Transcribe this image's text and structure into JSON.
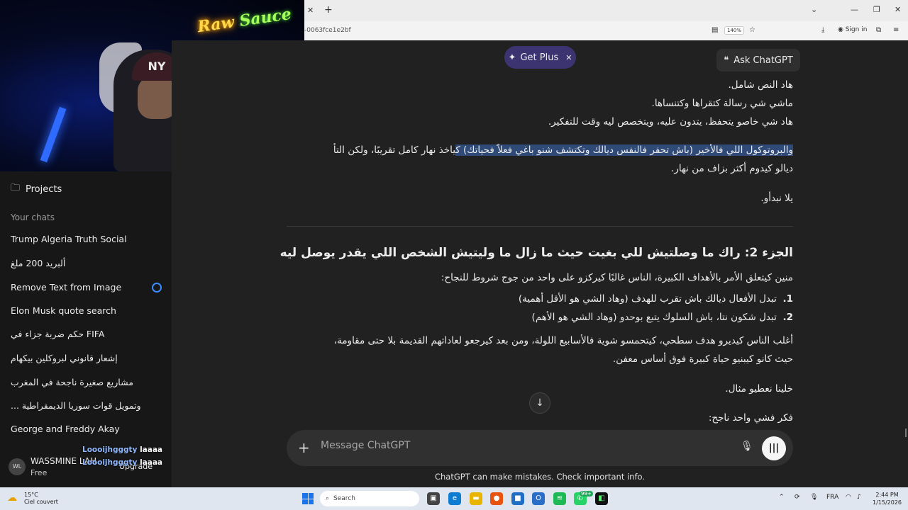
{
  "browser": {
    "url_fragment": "-0063fce1e2bf",
    "zoom": "140%",
    "signin_label": "Sign in"
  },
  "webcam": {
    "neon_text_a": "Raw",
    "neon_text_b": "Sauce"
  },
  "sidebar": {
    "projects_label": "Projects",
    "chats_heading": "Your chats",
    "chats": [
      "Trump Algeria Truth Social",
      "ألبريد 200 ملغ",
      "Remove Text from Image",
      "Elon Musk quote search",
      "حكم ضربة جزاء في FIFA",
      "إشعار قانوني لبروكلين بيكهام",
      "مشاريع صغيرة ناجحة في المغرب",
      "... وتمويل قوات سوريا الديمقراطية",
      "George and Freddy Akay"
    ],
    "user": {
      "initials": "WL",
      "name": "WASSMINE LAH",
      "plan": "Free",
      "upgrade_label": "Upgrade"
    }
  },
  "chat_overlay": [
    {
      "user": "Loooijhgggty",
      "msg": "laaaa"
    },
    {
      "user": "Loooijhgggty",
      "msg": "laaaa"
    }
  ],
  "header": {
    "getplus_label": "Get Plus",
    "askgpt_label": "Ask ChatGPT"
  },
  "content": {
    "line1": "هاد النص شامل.",
    "line2": "ماشي شي رسالة كتقراها وكتنساها.",
    "line3": "هاد شي خاصو يتحفظ، يتدون عليه، ويتخصص ليه وقت للتفكير.",
    "para_highlight": "والبروتوكول اللي فالأخير (باش تحفر فالنفس ديالك وتكتشف شنو باغي فعلاً فحياتك) ك",
    "para_rest": "ياخذ نهار كامل تقريبًا، ولكن التأ",
    "para_line2": "ديالو كيدوم أكثر بزاف من نهار.",
    "lets_start": "يلا نبدأو.",
    "heading": "الجزء 2: راك ما وصلتيش للي بغيت حيث ما زال ما وليتيش الشخص اللي يقدر يوصل ليه",
    "intro": "منين كيتعلق الأمر بالأهداف الكبيرة، الناس غالبًا كيركزو على واحد من جوج شروط للنجاح:",
    "list": [
      {
        "n": "1.",
        "text": "تبدل الأفعال ديالك باش تقرب للهدف (وهاد الشي هو الأقل أهمية)"
      },
      {
        "n": "2.",
        "text": "تبدل شكون نتا، باش السلوك يتبع بوحدو (وهاد الشي هو الأهم)"
      }
    ],
    "para2_line1": "أغلب الناس كيديرو هدف سطحي، كيتحمسو شوية فالأسابيع اللولة، ومن بعد كيرجعو لعاداتهم القديمة بلا حتى مقاومة،",
    "para2_line2": "حيث كانو كيبنيو حياة كبيرة فوق أساس معفن.",
    "example": "خلينا نعطيو مثال.",
    "think": "فكر فشي واحد ناجح:"
  },
  "composer": {
    "placeholder": "Message ChatGPT",
    "disclaimer": "ChatGPT can make mistakes. Check important info."
  },
  "taskbar": {
    "weather_temp": "15°C",
    "weather_desc": "Ciel couvert",
    "search_label": "Search",
    "badge": "99+",
    "lang": "FRA",
    "time": "2:44 PM",
    "date": "1/15/2026"
  }
}
